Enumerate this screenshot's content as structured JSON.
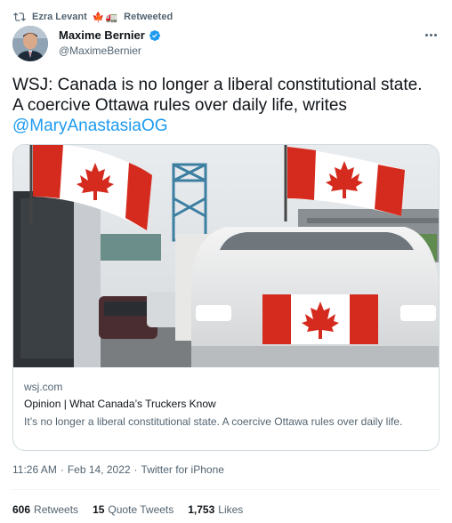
{
  "retweet": {
    "user": "Ezra Levant",
    "flags": "🍁🚛",
    "label": "Retweeted"
  },
  "author": {
    "name": "Maxime Bernier",
    "handle": "@MaximeBernier"
  },
  "tweet": {
    "text": "WSJ: Canada is no longer a liberal constitutional state. A coercive Ottawa rules over daily life, writes ",
    "mention": "@MaryAnastasiaOG"
  },
  "card": {
    "domain": "wsj.com",
    "title": "Opinion | What Canada’s Truckers Know",
    "description": "It’s no longer a liberal constitutional state. A coercive Ottawa rules over daily life."
  },
  "meta": {
    "time": "11:26 AM",
    "date": "Feb 14, 2022",
    "separator": "·",
    "source": "Twitter for iPhone"
  },
  "stats": {
    "retweets": {
      "count": "606",
      "label": "Retweets"
    },
    "quotes": {
      "count": "15",
      "label": "Quote Tweets"
    },
    "likes": {
      "count": "1,753",
      "label": "Likes"
    }
  },
  "icons": {
    "retweet": "retweet-icon",
    "verified": "verified-badge-icon",
    "more": "more-options-icon"
  },
  "colors": {
    "accent": "#1d9bf0",
    "text": "#0f1419",
    "secondary": "#536471",
    "flag_red": "#d52b1e"
  }
}
